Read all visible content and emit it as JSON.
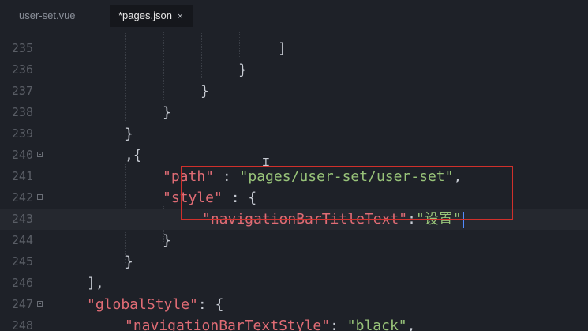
{
  "tabs": [
    {
      "label": "user-set.vue",
      "active": false
    },
    {
      "label": "*pages.json",
      "active": true,
      "close_glyph": "×"
    }
  ],
  "editor": {
    "lines": [
      {
        "num": "235",
        "fold": false,
        "segments": [
          {
            "t": "]",
            "c": "punc"
          }
        ]
      },
      {
        "num": "236",
        "fold": false,
        "segments": [
          {
            "t": "}",
            "c": "punc"
          }
        ]
      },
      {
        "num": "237",
        "fold": false,
        "segments": [
          {
            "t": "}",
            "c": "punc"
          }
        ]
      },
      {
        "num": "238",
        "fold": false,
        "segments": [
          {
            "t": "}",
            "c": "punc"
          }
        ]
      },
      {
        "num": "239",
        "fold": false,
        "segments": [
          {
            "t": "}",
            "c": "punc"
          }
        ]
      },
      {
        "num": "240",
        "fold": true,
        "segments": [
          {
            "t": ",{",
            "c": "punc"
          }
        ]
      },
      {
        "num": "241",
        "fold": false,
        "segments": [
          {
            "t": "\"path\"",
            "c": "key"
          },
          {
            "t": " : ",
            "c": "punc"
          },
          {
            "t": "\"pages/user-set/user-set\"",
            "c": "str"
          },
          {
            "t": ",",
            "c": "punc"
          }
        ]
      },
      {
        "num": "242",
        "fold": true,
        "segments": [
          {
            "t": "\"style\"",
            "c": "key"
          },
          {
            "t": " : {",
            "c": "punc"
          }
        ]
      },
      {
        "num": "243",
        "fold": false,
        "current": true,
        "segments": [
          {
            "t": "\"navigationBarTitleText\"",
            "c": "key"
          },
          {
            "t": ":",
            "c": "punc"
          },
          {
            "t": "\"",
            "c": "str"
          },
          {
            "t": "设置",
            "c": "cjk"
          },
          {
            "t": "\"",
            "c": "str"
          }
        ]
      },
      {
        "num": "244",
        "fold": false,
        "segments": [
          {
            "t": "}",
            "c": "punc"
          }
        ]
      },
      {
        "num": "245",
        "fold": false,
        "segments": [
          {
            "t": "}",
            "c": "punc"
          }
        ]
      },
      {
        "num": "246",
        "fold": false,
        "segments": [
          {
            "t": "],",
            "c": "punc"
          }
        ]
      },
      {
        "num": "247",
        "fold": true,
        "segments": [
          {
            "t": "\"globalStyle\"",
            "c": "key"
          },
          {
            "t": ": {",
            "c": "punc"
          }
        ]
      },
      {
        "num": "248",
        "fold": false,
        "segments": [
          {
            "t": "\"navigationBarTextStyle\"",
            "c": "key"
          },
          {
            "t": ": ",
            "c": "punc"
          },
          {
            "t": "\"black\"",
            "c": "str"
          },
          {
            "t": ",",
            "c": "punc"
          }
        ]
      }
    ]
  },
  "colors": {
    "background": "#1e2128",
    "key": "#e06c75",
    "string": "#98c379",
    "line_number": "#5a5e66",
    "highlight_box": "#d0302b",
    "caret": "#528bff"
  }
}
